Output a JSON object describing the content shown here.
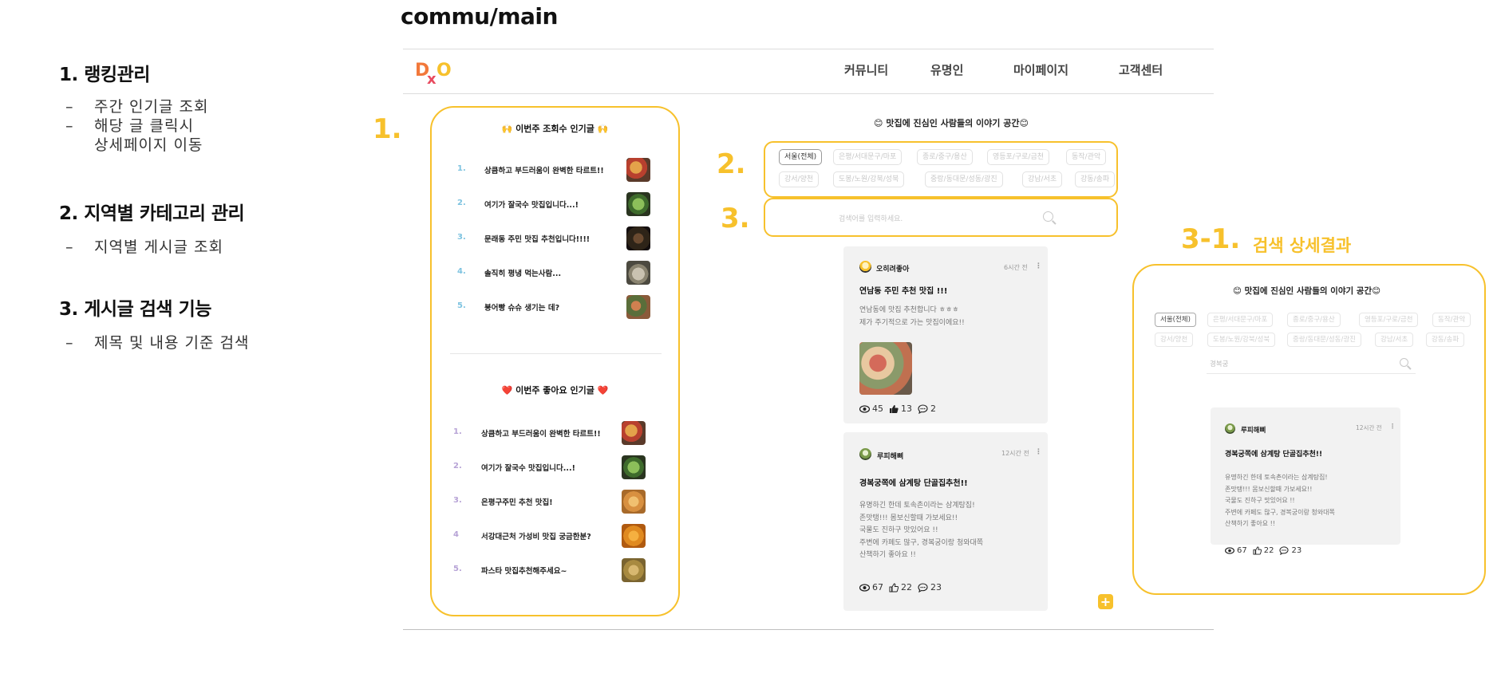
{
  "page_title": "commu/main",
  "notes": [
    {
      "title": "1. 랭킹관리",
      "items": [
        "주간 인기글 조회",
        "해당 글 클릭시",
        "상세페이지 이동"
      ]
    },
    {
      "title": "2. 지역별 카테고리 관리",
      "items": [
        "지역별 게시글 조회"
      ]
    },
    {
      "title": "3. 게시글 검색 기능",
      "items": [
        "제목 및 내용 기준 검색"
      ]
    }
  ],
  "logo": {
    "letters": [
      "D",
      "x",
      "O"
    ]
  },
  "nav": [
    "커뮤니티",
    "유명인",
    "마이페이지",
    "고객센터"
  ],
  "callouts": {
    "c1": "1.",
    "c2": "2.",
    "c3": "3.",
    "c31_num": "3-1.",
    "c31_label": "검색 상세결과"
  },
  "ranking_views": {
    "title": "🙌 이번주 조회수 인기글 🙌",
    "items": [
      {
        "num": "1.",
        "text": "상큼하고 부드러움이 완벽한 타르트!!"
      },
      {
        "num": "2.",
        "text": "여기가 잘국수 맛집입니다...!"
      },
      {
        "num": "3.",
        "text": "문래동 주민 맛집 추천입니다!!!!"
      },
      {
        "num": "4.",
        "text": "솔직히 평냉 먹는사람..."
      },
      {
        "num": "5.",
        "text": "붕어빵 슈슈 생기는 데?"
      }
    ]
  },
  "ranking_likes": {
    "title": "❤️ 이번주 좋아요 인기글 ❤️",
    "items": [
      {
        "num": "1.",
        "text": "상큼하고 부드러움이 완벽한 타르트!!"
      },
      {
        "num": "2.",
        "text": "여기가 잘국수 맛집입니다...!"
      },
      {
        "num": "3.",
        "text": "은평구주민 추천 맛집!"
      },
      {
        "num": "4",
        "text": "서강대근처 가성비 맛집 궁금한분?"
      },
      {
        "num": "5.",
        "text": "파스타 맛집추천해주세요~"
      }
    ]
  },
  "main": {
    "title": "😊 맛집에 진심인 사람들의 이야기 공간😊",
    "chips_row1": [
      "서울(전체)",
      "은평/서대문구/마포",
      "종로/중구/용산",
      "영등포/구로/금천",
      "동작/관악"
    ],
    "chips_row2": [
      "강서/양천",
      "도봉/노원/강북/성북",
      "중랑/동대문/성동/광진",
      "강남/서초",
      "강동/송파"
    ],
    "search_placeholder": "검색어를 입력하세요.",
    "posts": [
      {
        "user": "오히려좋아",
        "time": "6시간 전",
        "title": "연남동 주민 추천 맛집 !!!",
        "body": [
          "연남동에 맛집 추천합니다 ㅎㅎㅎ",
          "제가 주기적으로 가는 맛집이에요!!"
        ],
        "views": "45",
        "likes": "13",
        "comments": "2"
      },
      {
        "user": "루피해삐",
        "time": "12시간 전",
        "title": "경복궁쪽에 삼계탕 단골집추천!!",
        "body": [
          "유명하긴 한데 토속촌이라는 삼계탕집!",
          "존맛탱!!! 몸보신할때 가보세요!!",
          "국물도 진하구 맛있어요 !!",
          "주변에 카페도 많구, 경복궁이랑 청와대쪽",
          "산책하기 좋아요 !!"
        ],
        "views": "67",
        "likes": "22",
        "comments": "23"
      }
    ]
  },
  "detail": {
    "title": "😊 맛집에 진심인 사람들의 이야기 공간😊",
    "chips_row1": [
      "서울(전체)",
      "은평/서대문구/마포",
      "종로/중구/용산",
      "영등포/구로/금천",
      "동작/관악"
    ],
    "chips_row2": [
      "강서/양천",
      "도봉/노원/강북/성북",
      "중랑/동대문/성동/광진",
      "강남/서초",
      "강동/송파"
    ],
    "search_value": "경복궁",
    "post": {
      "user": "루피해삐",
      "time": "12시간 전",
      "title": "경복궁쪽에 삼계탕 단골집추천!!",
      "body": [
        "유명하긴 한데 토속촌이라는 삼계탕집!",
        "존맛탱!!! 몸보신할때 가보세요!!",
        "국물도 진하구 맛있어요 !!",
        "주변에 카페도 많구, 경복궁이랑 청와대쪽",
        "산책하기 좋아요 !!"
      ],
      "views": "67",
      "likes": "22",
      "comments": "23"
    }
  },
  "colors": {
    "accent": "#f7c12c",
    "rank_blue": "#7ec3e0",
    "rank_purple": "#b7a3d6",
    "logo_orange": "#f2783a",
    "logo_red": "#e84a5f",
    "logo_yellow": "#f7c12c"
  },
  "icons": [
    "search-icon",
    "eye-icon",
    "thumb-up-icon",
    "comment-icon",
    "more-icon",
    "plus-icon",
    "avatar-icon"
  ]
}
